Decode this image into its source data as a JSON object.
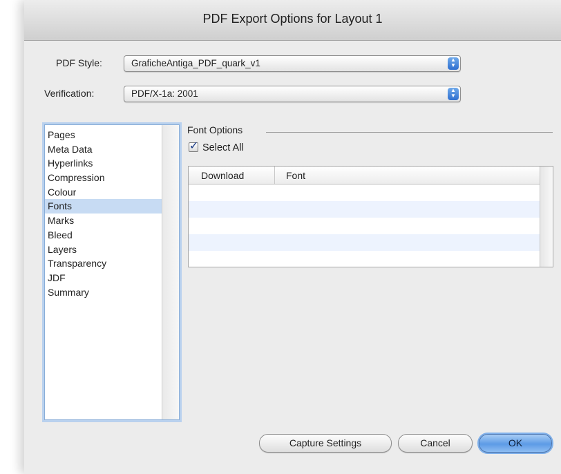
{
  "window": {
    "title": "PDF Export Options for Layout 1"
  },
  "pdf_style": {
    "label": "PDF Style:",
    "value": "GraficheAntiga_PDF_quark_v1"
  },
  "verification": {
    "label": "Verification:",
    "value": "PDF/X-1a: 2001"
  },
  "sidebar": {
    "items": [
      {
        "label": "Pages"
      },
      {
        "label": "Meta Data"
      },
      {
        "label": "Hyperlinks"
      },
      {
        "label": "Compression"
      },
      {
        "label": "Colour"
      },
      {
        "label": "Fonts",
        "selected": true
      },
      {
        "label": "Marks"
      },
      {
        "label": "Bleed"
      },
      {
        "label": "Layers"
      },
      {
        "label": "Transparency"
      },
      {
        "label": "JDF"
      },
      {
        "label": "Summary"
      }
    ]
  },
  "font_options": {
    "title": "Font Options",
    "select_all": {
      "label": "Select All",
      "checked": true
    },
    "table": {
      "columns": [
        "Download",
        "Font"
      ],
      "rows": []
    }
  },
  "buttons": {
    "capture": "Capture Settings",
    "cancel": "Cancel",
    "ok": "OK"
  },
  "colors": {
    "selection": "#c7dbf3",
    "default_button": "#5d9be6",
    "accent": "#2e6fd0"
  },
  "icons": {
    "popup": "up-down-stepper-icon",
    "checkbox": "checkmark-icon"
  }
}
